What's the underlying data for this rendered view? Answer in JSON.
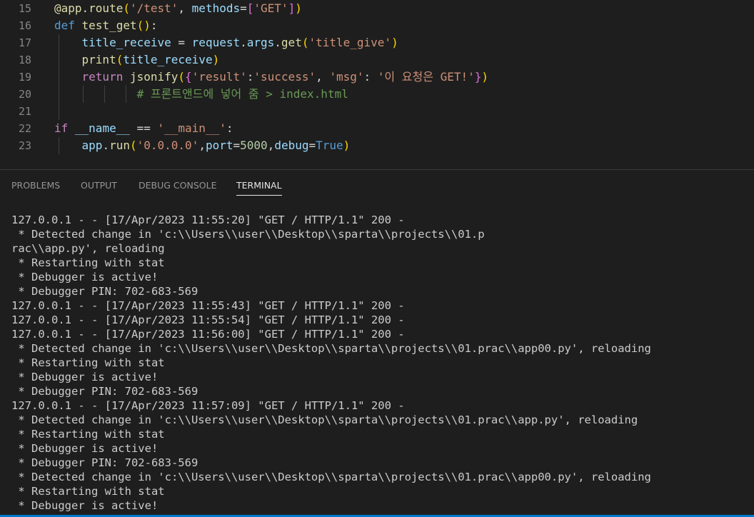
{
  "editor": {
    "lines": [
      {
        "num": "15",
        "tokens": [
          {
            "c": "t-dec",
            "t": "@app.route"
          },
          {
            "c": "t-br1",
            "t": "("
          },
          {
            "c": "t-str",
            "t": "'/test'"
          },
          {
            "c": "t-txt",
            "t": ", "
          },
          {
            "c": "t-var",
            "t": "methods"
          },
          {
            "c": "t-txt",
            "t": "="
          },
          {
            "c": "t-br2",
            "t": "["
          },
          {
            "c": "t-str",
            "t": "'GET'"
          },
          {
            "c": "t-br2",
            "t": "]"
          },
          {
            "c": "t-br1",
            "t": ")"
          }
        ]
      },
      {
        "num": "16",
        "tokens": [
          {
            "c": "t-kw",
            "t": "def"
          },
          {
            "c": "t-txt",
            "t": " "
          },
          {
            "c": "t-fn",
            "t": "test_get"
          },
          {
            "c": "t-br1",
            "t": "()"
          },
          {
            "c": "t-txt",
            "t": ":"
          }
        ]
      },
      {
        "num": "17",
        "tokens": [
          {
            "c": "t-txt",
            "t": "    "
          },
          {
            "c": "t-var",
            "t": "title_receive"
          },
          {
            "c": "t-txt",
            "t": " = "
          },
          {
            "c": "t-var",
            "t": "request"
          },
          {
            "c": "t-txt",
            "t": "."
          },
          {
            "c": "t-var",
            "t": "args"
          },
          {
            "c": "t-txt",
            "t": "."
          },
          {
            "c": "t-fn",
            "t": "get"
          },
          {
            "c": "t-br1",
            "t": "("
          },
          {
            "c": "t-str",
            "t": "'title_give'"
          },
          {
            "c": "t-br1",
            "t": ")"
          }
        ]
      },
      {
        "num": "18",
        "tokens": [
          {
            "c": "t-txt",
            "t": "    "
          },
          {
            "c": "t-fn",
            "t": "print"
          },
          {
            "c": "t-br1",
            "t": "("
          },
          {
            "c": "t-var",
            "t": "title_receive"
          },
          {
            "c": "t-br1",
            "t": ")"
          }
        ]
      },
      {
        "num": "19",
        "tokens": [
          {
            "c": "t-txt",
            "t": "    "
          },
          {
            "c": "t-ctl",
            "t": "return"
          },
          {
            "c": "t-txt",
            "t": " "
          },
          {
            "c": "t-fn",
            "t": "jsonify"
          },
          {
            "c": "t-br1",
            "t": "("
          },
          {
            "c": "t-br2",
            "t": "{"
          },
          {
            "c": "t-str",
            "t": "'result'"
          },
          {
            "c": "t-txt",
            "t": ":"
          },
          {
            "c": "t-str",
            "t": "'success'"
          },
          {
            "c": "t-txt",
            "t": ", "
          },
          {
            "c": "t-str",
            "t": "'msg'"
          },
          {
            "c": "t-txt",
            "t": ": "
          },
          {
            "c": "t-str",
            "t": "'이 요청은 GET!'"
          },
          {
            "c": "t-br2",
            "t": "}"
          },
          {
            "c": "t-br1",
            "t": ")"
          }
        ]
      },
      {
        "num": "20",
        "tokens": [
          {
            "c": "t-txt",
            "t": "            "
          },
          {
            "c": "t-com",
            "t": "# 프론트앤드에 넣어 줌 > index.html"
          }
        ]
      },
      {
        "num": "21",
        "tokens": []
      },
      {
        "num": "22",
        "tokens": [
          {
            "c": "t-ctl",
            "t": "if"
          },
          {
            "c": "t-txt",
            "t": " "
          },
          {
            "c": "t-var",
            "t": "__name__"
          },
          {
            "c": "t-txt",
            "t": " == "
          },
          {
            "c": "t-str",
            "t": "'__main__'"
          },
          {
            "c": "t-txt",
            "t": ":"
          }
        ]
      },
      {
        "num": "23",
        "tokens": [
          {
            "c": "t-txt",
            "t": "    "
          },
          {
            "c": "t-var",
            "t": "app"
          },
          {
            "c": "t-txt",
            "t": "."
          },
          {
            "c": "t-fn",
            "t": "run"
          },
          {
            "c": "t-br1",
            "t": "("
          },
          {
            "c": "t-str",
            "t": "'0.0.0.0'"
          },
          {
            "c": "t-txt",
            "t": ","
          },
          {
            "c": "t-var",
            "t": "port"
          },
          {
            "c": "t-txt",
            "t": "="
          },
          {
            "c": "t-num",
            "t": "5000"
          },
          {
            "c": "t-txt",
            "t": ","
          },
          {
            "c": "t-var",
            "t": "debug"
          },
          {
            "c": "t-txt",
            "t": "="
          },
          {
            "c": "t-bool",
            "t": "True"
          },
          {
            "c": "t-br1",
            "t": ")"
          }
        ]
      }
    ]
  },
  "panel": {
    "tabs": {
      "problems": "PROBLEMS",
      "output": "OUTPUT",
      "debug_console": "DEBUG CONSOLE",
      "terminal": "TERMINAL"
    },
    "active_tab": "TERMINAL"
  },
  "terminal": {
    "lines": [
      "127.0.0.1 - - [17/Apr/2023 11:55:20] \"GET / HTTP/1.1\" 200 -",
      " * Detected change in 'c:\\\\Users\\\\user\\\\Desktop\\\\sparta\\\\projects\\\\01.p",
      "rac\\\\app.py', reloading",
      " * Restarting with stat",
      " * Debugger is active!",
      " * Debugger PIN: 702-683-569",
      "127.0.0.1 - - [17/Apr/2023 11:55:43] \"GET / HTTP/1.1\" 200 -",
      "127.0.0.1 - - [17/Apr/2023 11:55:54] \"GET / HTTP/1.1\" 200 -",
      "127.0.0.1 - - [17/Apr/2023 11:56:00] \"GET / HTTP/1.1\" 200 -",
      " * Detected change in 'c:\\\\Users\\\\user\\\\Desktop\\\\sparta\\\\projects\\\\01.prac\\\\app00.py', reloading",
      " * Restarting with stat",
      " * Debugger is active!",
      " * Debugger PIN: 702-683-569",
      "127.0.0.1 - - [17/Apr/2023 11:57:09] \"GET / HTTP/1.1\" 200 -",
      " * Detected change in 'c:\\\\Users\\\\user\\\\Desktop\\\\sparta\\\\projects\\\\01.prac\\\\app.py', reloading",
      " * Restarting with stat",
      " * Debugger is active!",
      " * Debugger PIN: 702-683-569",
      " * Detected change in 'c:\\\\Users\\\\user\\\\Desktop\\\\sparta\\\\projects\\\\01.prac\\\\app00.py', reloading",
      " * Restarting with stat",
      " * Debugger is active!"
    ]
  }
}
